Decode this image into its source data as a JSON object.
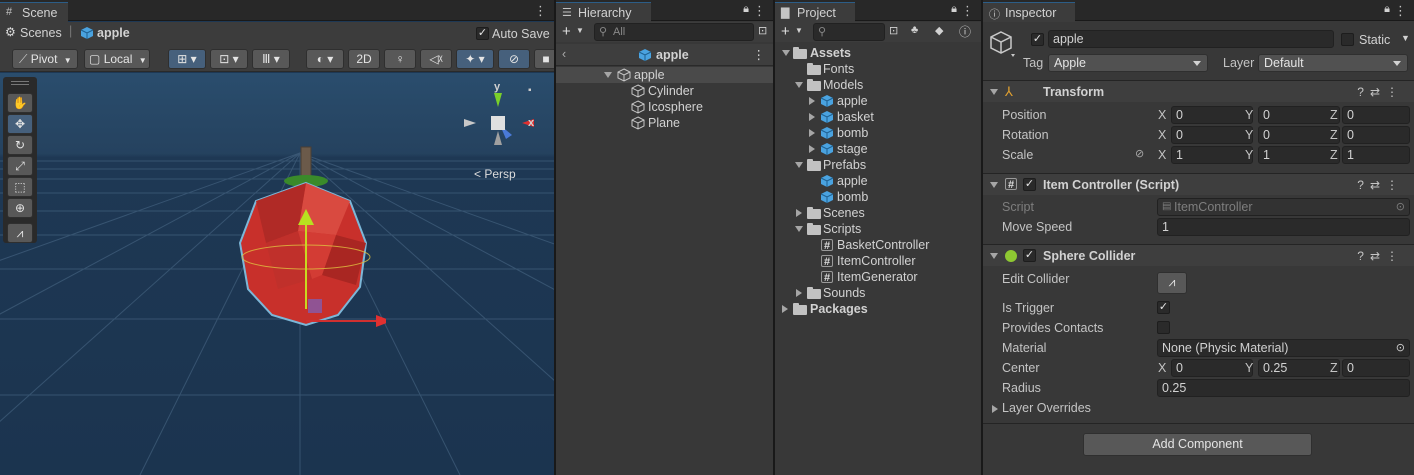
{
  "scene": {
    "tab": "Scene",
    "breadcrumb_root": "Scenes",
    "breadcrumb_object": "apple",
    "auto_save": "Auto Save",
    "pivot": "Pivot",
    "local": "Local",
    "mode_2d": "2D",
    "persp": "Persp",
    "gizmo_y": "y",
    "gizmo_x": "x"
  },
  "hierarchy": {
    "tab": "Hierarchy",
    "search_placeholder": "All",
    "header": "apple",
    "items": [
      {
        "label": "apple"
      },
      {
        "label": "Cylinder"
      },
      {
        "label": "Icosphere"
      },
      {
        "label": "Plane"
      }
    ]
  },
  "project": {
    "tab": "Project",
    "items": [
      {
        "label": "Assets"
      },
      {
        "label": "Fonts"
      },
      {
        "label": "Models"
      },
      {
        "label": "apple"
      },
      {
        "label": "basket"
      },
      {
        "label": "bomb"
      },
      {
        "label": "stage"
      },
      {
        "label": "Prefabs"
      },
      {
        "label": "apple"
      },
      {
        "label": "bomb"
      },
      {
        "label": "Scenes"
      },
      {
        "label": "Scripts"
      },
      {
        "label": "BasketController"
      },
      {
        "label": "ItemController"
      },
      {
        "label": "ItemGenerator"
      },
      {
        "label": "Sounds"
      },
      {
        "label": "Packages"
      }
    ]
  },
  "inspector": {
    "tab": "Inspector",
    "name": "apple",
    "static": "Static",
    "tag_label": "Tag",
    "tag_value": "Apple",
    "layer_label": "Layer",
    "layer_value": "Default",
    "transform": {
      "title": "Transform",
      "position_label": "Position",
      "rotation_label": "Rotation",
      "scale_label": "Scale",
      "x": "X",
      "y": "Y",
      "z": "Z",
      "position": [
        "0",
        "0",
        "0"
      ],
      "rotation": [
        "0",
        "0",
        "0"
      ],
      "scale": [
        "1",
        "1",
        "1"
      ]
    },
    "item_controller": {
      "title": "Item Controller (Script)",
      "script_label": "Script",
      "script_value": "ItemController",
      "move_speed_label": "Move Speed",
      "move_speed_value": "1"
    },
    "sphere_collider": {
      "title": "Sphere Collider",
      "edit_collider": "Edit Collider",
      "is_trigger": "Is Trigger",
      "provides_contacts": "Provides Contacts",
      "material_label": "Material",
      "material_value": "None (Physic Material)",
      "center_label": "Center",
      "center": [
        "0",
        "0.25",
        "0"
      ],
      "radius_label": "Radius",
      "radius_value": "0.25",
      "layer_overrides": "Layer Overrides"
    },
    "add_component": "Add Component"
  },
  "colors": {
    "accent": "#46607c",
    "apple_red": "#c8302b",
    "sky": "#1f3a55"
  }
}
